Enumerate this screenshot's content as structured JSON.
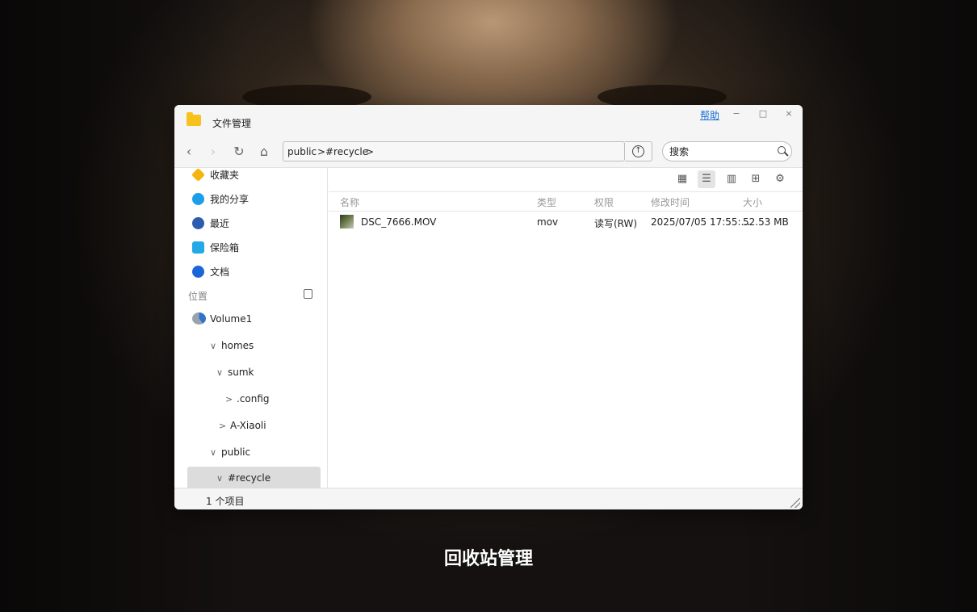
{
  "window": {
    "title": "文件管理",
    "help": "帮助",
    "minimize": "−",
    "maximize": "□",
    "close": "×"
  },
  "toolbar": {
    "back": "‹",
    "forward": "›",
    "refresh": "↻",
    "home": "⌂",
    "breadcrumb": [
      "public",
      ">",
      "#recycle",
      ">"
    ],
    "upload_glyph": "↑",
    "search_placeholder": "搜索"
  },
  "sidebar": {
    "items": [
      {
        "label": "收藏夹",
        "icon": "star-icon",
        "color": "#f5b50d"
      },
      {
        "label": "我的分享",
        "icon": "share-icon",
        "color": "#1c9ee8"
      },
      {
        "label": "最近",
        "icon": "clock-icon",
        "color": "#2c5bb0"
      },
      {
        "label": "保险箱",
        "icon": "safe-box-icon",
        "color": "#24a8e8"
      },
      {
        "label": "文档",
        "icon": "document-icon",
        "color": "#1a66d6"
      }
    ],
    "section_label": "位置",
    "tree": [
      {
        "label": "Volume1",
        "chevron": ""
      },
      {
        "label": "homes",
        "chevron": "∨"
      },
      {
        "label": "sumk",
        "chevron": "∨"
      },
      {
        "label": ".config",
        "chevron": ">"
      },
      {
        "label": "A-Xiaoli",
        "chevron": ">"
      },
      {
        "label": "public",
        "chevron": "∨"
      },
      {
        "label": "#recycle",
        "chevron": "∨"
      }
    ]
  },
  "main": {
    "view_buttons": [
      "grid-view",
      "list-view",
      "column-view",
      "new-folder",
      "settings"
    ],
    "columns": [
      "名称",
      "类型",
      "权限",
      "修改时间",
      "大小"
    ],
    "rows": [
      {
        "name": "DSC_7666.MOV",
        "type": "mov",
        "permission": "读写(RW)",
        "modified": "2025/07/05 17:55:...",
        "size": "52.53 MB"
      }
    ]
  },
  "status": {
    "count": "1 个项目"
  },
  "caption": "回收站管理"
}
